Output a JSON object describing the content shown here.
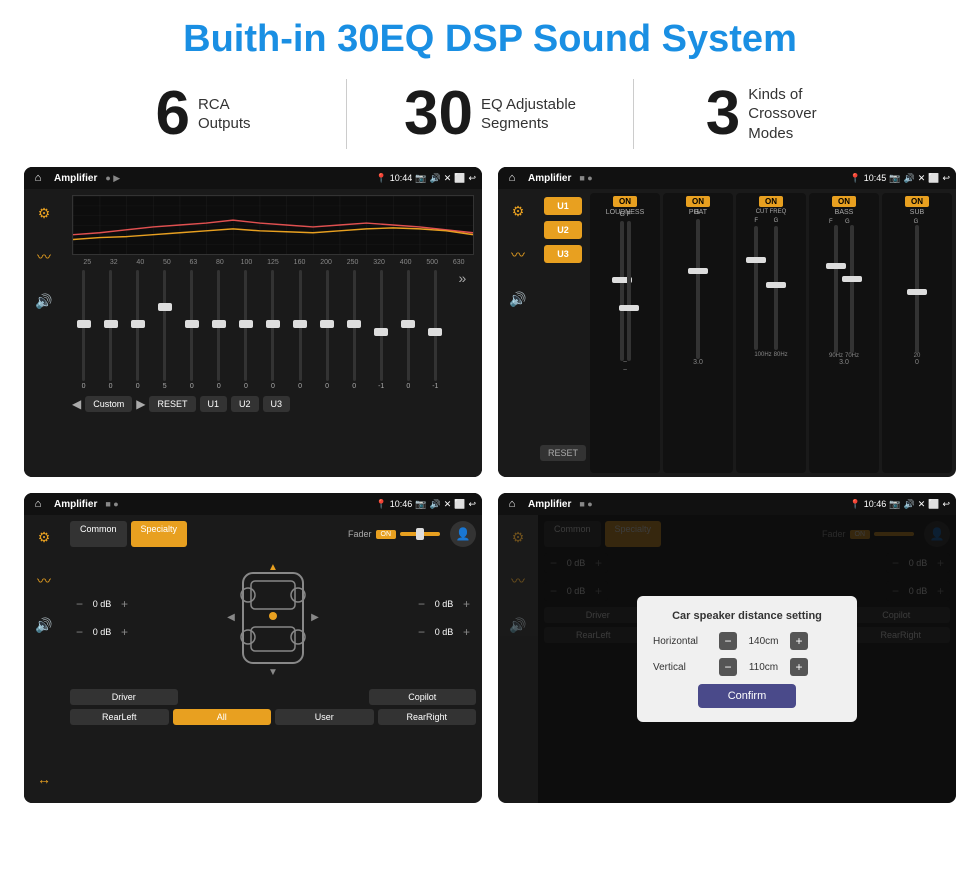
{
  "page": {
    "title": "Buith-in 30EQ DSP Sound System"
  },
  "stats": [
    {
      "number": "6",
      "label_line1": "RCA",
      "label_line2": "Outputs"
    },
    {
      "number": "30",
      "label_line1": "EQ Adjustable",
      "label_line2": "Segments"
    },
    {
      "number": "3",
      "label_line1": "Kinds of",
      "label_line2": "Crossover Modes"
    }
  ],
  "screens": [
    {
      "id": "screen1",
      "status_bar": {
        "title": "Amplifier",
        "time": "10:44"
      },
      "eq_frequencies": [
        "25",
        "32",
        "40",
        "50",
        "63",
        "80",
        "100",
        "125",
        "160",
        "200",
        "250",
        "320",
        "400",
        "500",
        "630"
      ],
      "eq_values": [
        "0",
        "0",
        "0",
        "5",
        "0",
        "0",
        "0",
        "0",
        "0",
        "0",
        "0",
        "-1",
        "0",
        "-1"
      ],
      "buttons": [
        "Custom",
        "RESET",
        "U1",
        "U2",
        "U3"
      ]
    },
    {
      "id": "screen2",
      "status_bar": {
        "title": "Amplifier",
        "time": "10:45"
      },
      "presets": [
        "U1",
        "U2",
        "U3"
      ],
      "channels": [
        {
          "name": "LOUDNESS",
          "on": true
        },
        {
          "name": "PHAT",
          "on": true
        },
        {
          "name": "CUT FREQ",
          "on": true
        },
        {
          "name": "BASS",
          "on": true
        },
        {
          "name": "SUB",
          "on": true
        }
      ],
      "reset_label": "RESET"
    },
    {
      "id": "screen3",
      "status_bar": {
        "title": "Amplifier",
        "time": "10:46"
      },
      "tabs": [
        "Common",
        "Specialty"
      ],
      "fader_label": "Fader",
      "fader_on": "ON",
      "db_values": [
        "0 dB",
        "0 dB",
        "0 dB",
        "0 dB"
      ],
      "buttons": [
        "Driver",
        "Copilot",
        "RearLeft",
        "All",
        "User",
        "RearRight"
      ]
    },
    {
      "id": "screen4",
      "status_bar": {
        "title": "Amplifier",
        "time": "10:46"
      },
      "tabs": [
        "Common",
        "Specialty"
      ],
      "dialog": {
        "title": "Car speaker distance setting",
        "horizontal_label": "Horizontal",
        "horizontal_value": "140cm",
        "vertical_label": "Vertical",
        "vertical_value": "110cm",
        "confirm_label": "Confirm"
      },
      "db_values": [
        "0 dB",
        "0 dB"
      ],
      "buttons": [
        "Driver",
        "Copilot",
        "RearLeft",
        "All",
        "User",
        "RearRight"
      ]
    }
  ]
}
